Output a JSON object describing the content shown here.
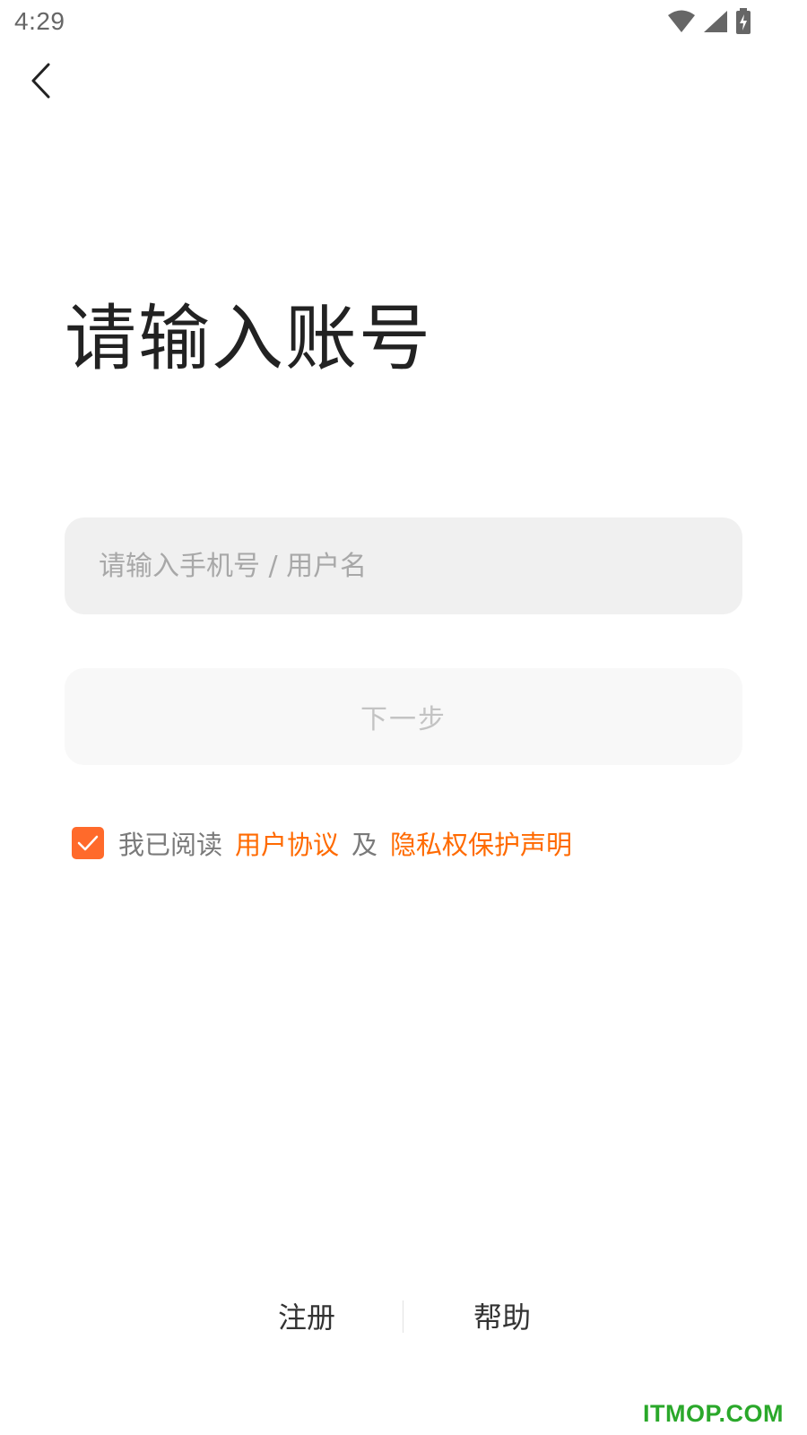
{
  "status_bar": {
    "time": "4:29",
    "icons": [
      "wifi-icon",
      "cellular-signal-icon",
      "battery-charging-icon"
    ]
  },
  "header": {
    "back_icon": "chevron-left-icon"
  },
  "main": {
    "title": "请输入账号",
    "account_input": {
      "value": "",
      "placeholder": "请输入手机号 / 用户名"
    },
    "next_button_label": "下一步",
    "agreement": {
      "checked": true,
      "prefix": "我已阅读",
      "user_agreement_link": "用户协议",
      "conjunction": "及",
      "privacy_link": "隐私权保护声明"
    }
  },
  "footer": {
    "register_label": "注册",
    "help_label": "帮助"
  },
  "watermark": "ITMOP.COM",
  "colors": {
    "accent": "#ff6a00",
    "checkbox": "#ff6a2b",
    "input_bg": "#f0f0f0",
    "button_disabled_bg": "#f8f8f8",
    "watermark": "#2aa82a"
  }
}
